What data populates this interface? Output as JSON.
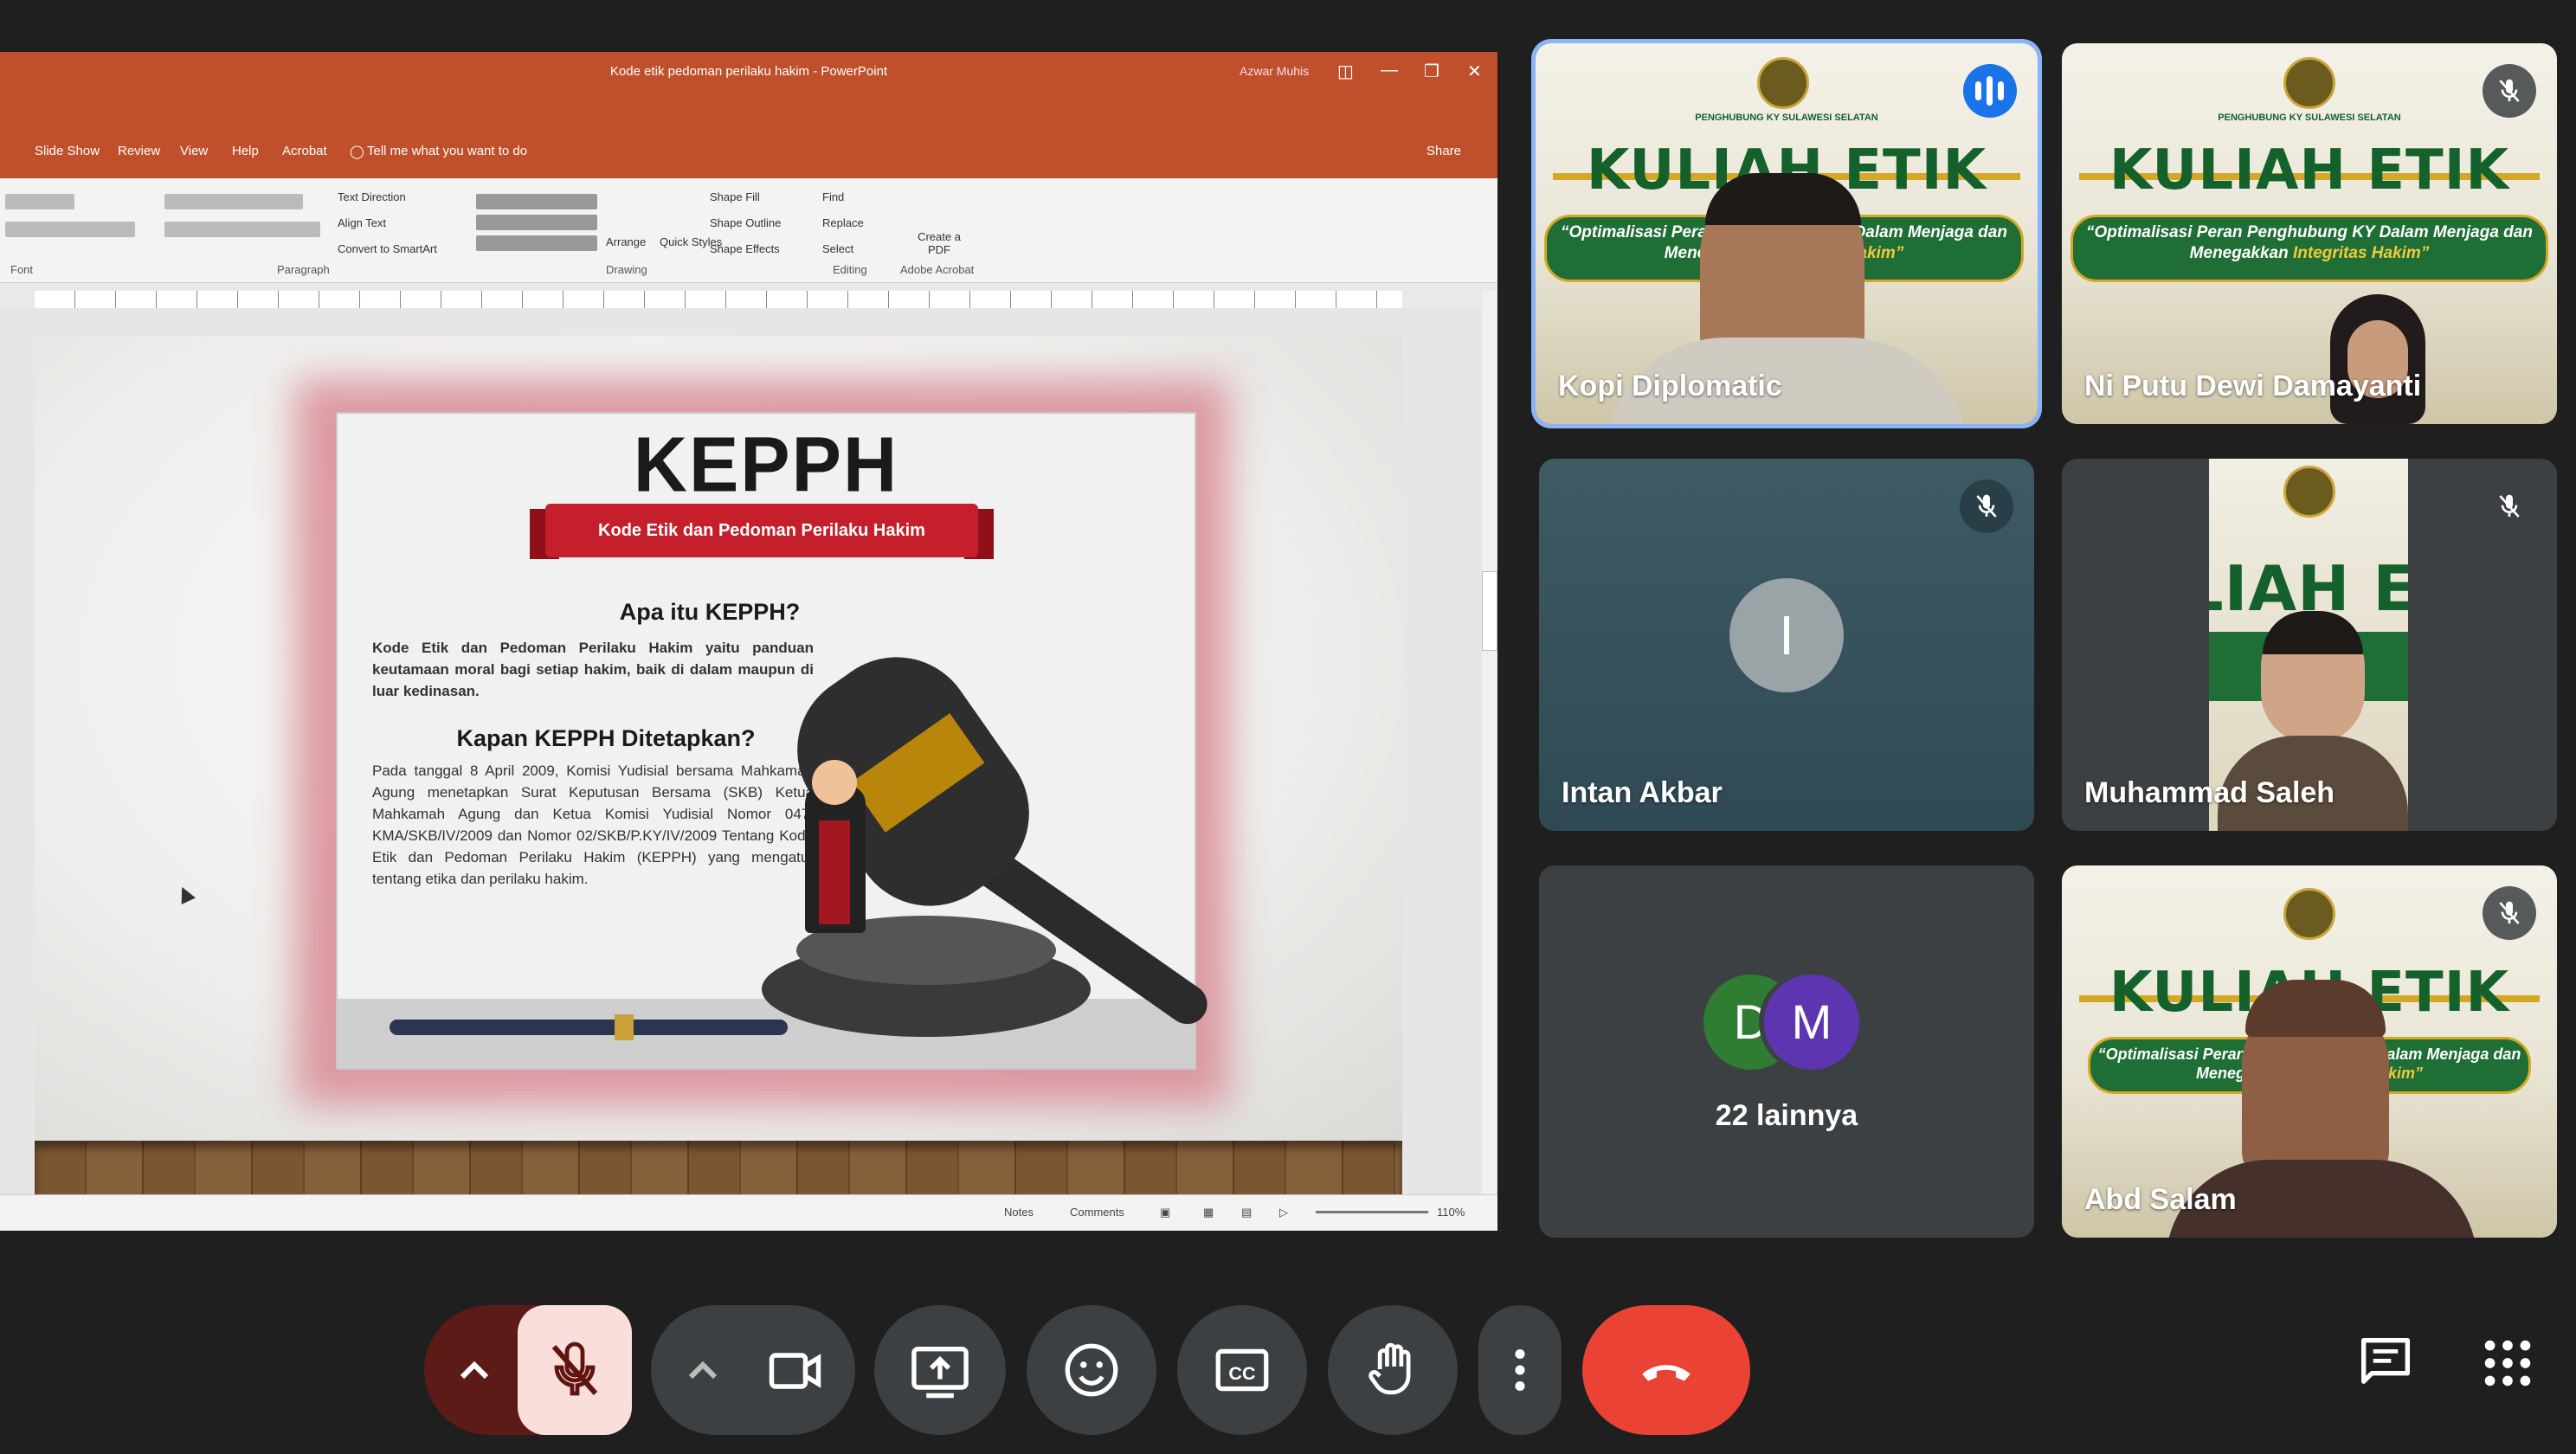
{
  "powerpoint": {
    "doc_title": "Kode etik pedoman perilaku hakim - PowerPoint",
    "user_name": "Azwar Muhis",
    "share_label": "Share",
    "tell_me": "Tell me what you want to do",
    "menu": [
      "Slide Show",
      "Review",
      "View",
      "Help",
      "Acrobat"
    ],
    "ribbon_groups": [
      "Font",
      "Paragraph",
      "Drawing",
      "Editing",
      "Adobe Acrobat"
    ],
    "ribbon_items": {
      "text_direction": "Text Direction",
      "align_text": "Align Text",
      "convert_smartart": "Convert to SmartArt",
      "arrange": "Arrange",
      "quick_styles": "Quick Styles",
      "shape_fill": "Shape Fill",
      "shape_outline": "Shape Outline",
      "shape_effects": "Shape Effects",
      "find": "Find",
      "replace": "Replace",
      "select": "Select",
      "create_pdf": "Create a PDF"
    },
    "status": {
      "notes": "Notes",
      "comments": "Comments",
      "zoom": "110%"
    }
  },
  "slide": {
    "title": "KEPPH",
    "banner": "Kode Etik dan Pedoman Perilaku Hakim",
    "q1": "Apa itu KEPPH?",
    "a1": "Kode Etik dan Pedoman Perilaku Hakim yaitu panduan keutamaan moral bagi setiap hakim, baik di dalam maupun di luar kedinasan.",
    "q2": "Kapan KEPPH Ditetapkan?",
    "a2": "Pada tanggal 8 April 2009, Komisi Yudisial bersama Mahkamah Agung menetapkan Surat Keputusan Bersama (SKB) Ketua Mahkamah Agung dan Ketua Komisi Yudisial Nomor 047/ KMA/SKB/IV/2009 dan Nomor 02/SKB/P.KY/IV/2009 Tentang Kode Etik dan Pedoman Perilaku Hakim (KEPPH) yang mengatur tentang etika dan perilaku hakim."
  },
  "banner_text": {
    "title": "KULIAH ETIK",
    "org": "PENGHUBUNG KY SULAWESI SELATAN",
    "subtitle_a": "“Optimalisasi Peran Penghubung KY Dalam Menjaga dan",
    "subtitle_b": "Menegakkan",
    "subtitle_c": "Integritas Hakim”"
  },
  "participants": [
    {
      "name": "Kopi Diplomatic",
      "speaking": true
    },
    {
      "name": "Ni Putu Dewi Damayanti",
      "muted": true
    },
    {
      "name": "Intan Akbar",
      "initial": "I",
      "muted": true
    },
    {
      "name": "Muhammad Saleh",
      "muted": true
    },
    {
      "others_label": "22 lainnya",
      "initials": [
        "D",
        "M"
      ]
    },
    {
      "name": "Abd Salam",
      "muted": true
    }
  ],
  "colors": {
    "tile_bg": "#3c4043",
    "active_ring": "#8ab4f8",
    "end_call": "#ea4335",
    "mic_off_bg": "#f9dedc",
    "ppt_title": "#c0502c",
    "avatar_d": "#2e7d32",
    "avatar_m": "#5e35b1"
  },
  "controls": [
    {
      "name": "mic-options",
      "icon": "chevron-up-icon"
    },
    {
      "name": "mic",
      "icon": "mic-off-icon"
    },
    {
      "name": "camera-options",
      "icon": "chevron-up-icon"
    },
    {
      "name": "camera",
      "icon": "camera-icon"
    },
    {
      "name": "present",
      "icon": "present-screen-icon"
    },
    {
      "name": "reactions",
      "icon": "emoji-icon"
    },
    {
      "name": "captions",
      "icon": "captions-icon"
    },
    {
      "name": "raise-hand",
      "icon": "hand-icon"
    },
    {
      "name": "more",
      "icon": "more-vert-icon"
    },
    {
      "name": "leave",
      "icon": "end-call-icon"
    },
    {
      "name": "chat",
      "icon": "chat-icon"
    },
    {
      "name": "activities",
      "icon": "apps-grid-icon"
    }
  ]
}
